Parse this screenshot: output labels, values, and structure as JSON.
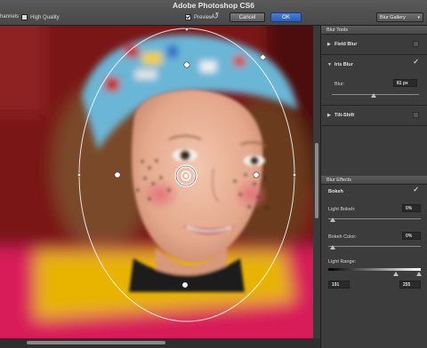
{
  "app": {
    "title": "Adobe Photoshop CS6"
  },
  "topbar": {
    "channels_label": "hannels",
    "high_quality_label": "High Quality",
    "high_quality_checked": false,
    "preview_label": "Preview",
    "preview_checked": true,
    "cancel_label": "Cancel",
    "ok_label": "OK",
    "gallery_label": "Blur Gallery"
  },
  "blur_tools": {
    "header": "Blur Tools",
    "field_blur": {
      "label": "Field Blur",
      "enabled": false
    },
    "iris_blur": {
      "label": "Iris Blur",
      "enabled": true,
      "blur_label": "Blur:",
      "blur_value": "81 px"
    },
    "tilt_shift": {
      "label": "Tilt-Shift",
      "enabled": false
    }
  },
  "blur_effects": {
    "header": "Blur Effects",
    "bokeh": {
      "label": "Bokeh",
      "enabled": true
    },
    "light_bokeh": {
      "label": "Light Bokeh:",
      "value": "0%"
    },
    "bokeh_color": {
      "label": "Bokeh Color:",
      "value": "0%"
    },
    "light_range": {
      "label": "Light Range:",
      "low": "191",
      "high": "255"
    }
  },
  "icons": {
    "undo": "undo-icon",
    "checkbox": "checkbox-icon",
    "expand": "chevron-right-icon",
    "collapse": "chevron-down-icon",
    "dropdown": "chevron-down-icon"
  },
  "colors": {
    "ok_button": "#2b5eb8",
    "panel_bg": "#3c3c3c",
    "background_red": "#7a1818",
    "hat_blue": "#6ab6d6",
    "jacket_yellow": "#e8b400",
    "jacket_pink": "#d81e5a"
  }
}
